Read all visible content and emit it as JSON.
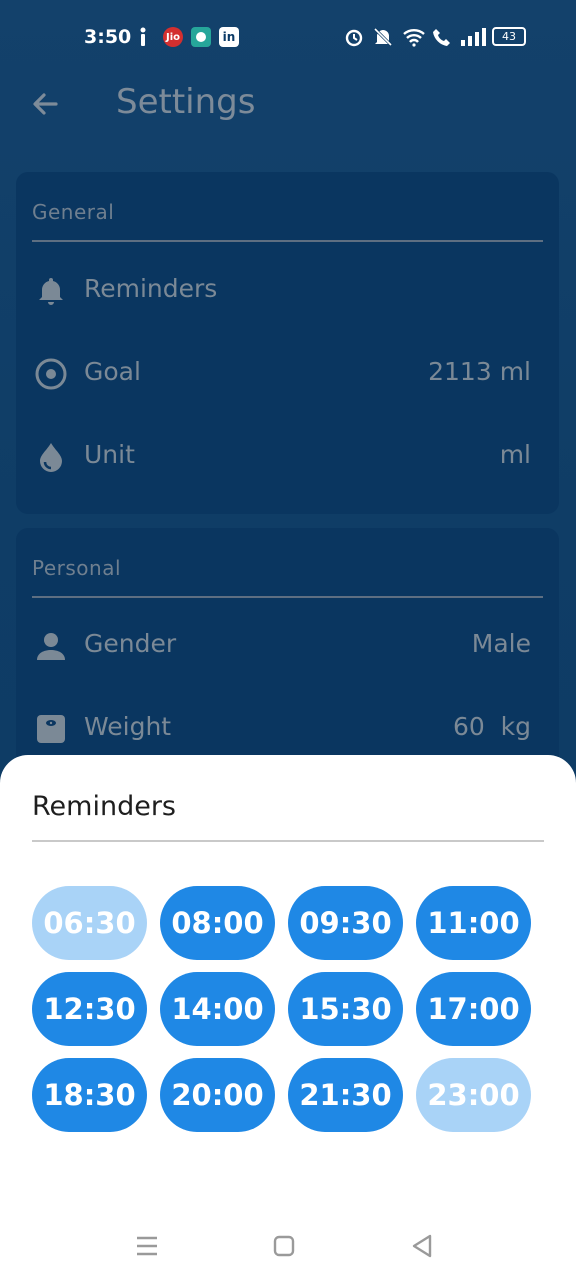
{
  "status_bar": {
    "time": "3:50",
    "battery": "43",
    "left_icons": [
      "info-icon",
      "jio-icon",
      "app-icon",
      "linkedin-icon"
    ],
    "right_icons": [
      "alarm-icon",
      "mute-icon",
      "wifi-icon",
      "call-icon",
      "signal-icon",
      "battery-icon"
    ]
  },
  "app_bar": {
    "title": "Settings",
    "back_icon": "arrow-left-icon"
  },
  "general": {
    "title": "General",
    "items": [
      {
        "label": "Reminders",
        "value": "",
        "icon": "bell-icon"
      },
      {
        "label": "Goal",
        "value": "2113 ml",
        "icon": "target-icon"
      },
      {
        "label": "Unit",
        "value": "ml",
        "icon": "drop-icon"
      }
    ]
  },
  "personal": {
    "title": "Personal",
    "items": [
      {
        "label": "Gender",
        "value": "Male",
        "icon": "person-icon"
      },
      {
        "label": "Weight",
        "value": "60  kg",
        "icon": "scale-icon"
      }
    ]
  },
  "sheet": {
    "title": "Reminders",
    "times": [
      {
        "label": "06:30",
        "enabled": false
      },
      {
        "label": "08:00",
        "enabled": true
      },
      {
        "label": "09:30",
        "enabled": true
      },
      {
        "label": "11:00",
        "enabled": true
      },
      {
        "label": "12:30",
        "enabled": true
      },
      {
        "label": "14:00",
        "enabled": true
      },
      {
        "label": "15:30",
        "enabled": true
      },
      {
        "label": "17:00",
        "enabled": true
      },
      {
        "label": "18:30",
        "enabled": true
      },
      {
        "label": "20:00",
        "enabled": true
      },
      {
        "label": "21:30",
        "enabled": true
      },
      {
        "label": "23:00",
        "enabled": false
      }
    ]
  },
  "colors": {
    "chip_on": "#1f88e5",
    "chip_off": "#a9d3f7",
    "background": "#0f3d66"
  },
  "nav": [
    "menu-icon",
    "home-icon",
    "back-triangle-icon"
  ]
}
